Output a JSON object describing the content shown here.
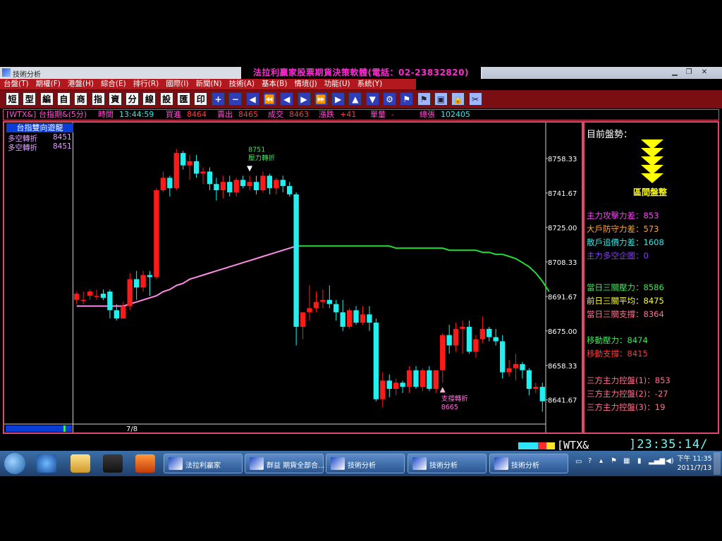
{
  "window": {
    "app_title": "技術分析",
    "banner": "法拉利贏家股票期貨決策軟體(電話：02-23832820)"
  },
  "menu": [
    "台盤(T)",
    "期權(F)",
    "港盤(H)",
    "綜合(E)",
    "排行(R)",
    "國際(I)",
    "新聞(N)",
    "技術(A)",
    "基本(B)",
    "情境(J)",
    "功能(U)",
    "系統(Y)"
  ],
  "toolbar": [
    "短",
    "型",
    "編",
    "自",
    "商",
    "指",
    "資",
    "分",
    "線",
    "設",
    "匯",
    "印"
  ],
  "infobar": {
    "symbol": "[WTX&]",
    "name": "台指期&(5分)",
    "time_label": "時間",
    "time": "13:44:59",
    "bid_label": "買進",
    "bid": "8464",
    "ask_label": "賣出",
    "ask": "8465",
    "deal_label": "成交",
    "deal": "8463",
    "change_label": "漲跌",
    "change": "+41",
    "volume_label": "單量",
    "volume": "-",
    "total_label": "總張",
    "total": "102405"
  },
  "legend": {
    "title": "台指雙向遊龍",
    "lines": [
      {
        "label": "多空轉折",
        "value": "8451"
      },
      {
        "label": "多空轉折",
        "value": "8451"
      }
    ]
  },
  "chart_data": {
    "type": "candlestick",
    "date_label": "7/8",
    "y_ticks": [
      "8758.33",
      "8741.67",
      "8725.00",
      "8708.33",
      "8691.67",
      "8675.00",
      "8658.33",
      "8641.67"
    ],
    "ylim": [
      8630,
      8775
    ],
    "annotations": [
      {
        "text_top": "8751",
        "text_bottom": "壓力轉折",
        "index": 26,
        "direction": "down"
      },
      {
        "text_top": "支撐轉折",
        "text_bottom": "8665",
        "index": 55,
        "direction": "up"
      }
    ],
    "candles": [
      [
        8690,
        8694,
        8688,
        8693
      ],
      [
        8690,
        8694,
        8688,
        8690
      ],
      [
        8692,
        8695,
        8690,
        8694
      ],
      [
        8692,
        8695,
        8690,
        8692
      ],
      [
        8693,
        8695,
        8690,
        8691
      ],
      [
        8694,
        8695,
        8681,
        8685
      ],
      [
        8685,
        8688,
        8680,
        8681
      ],
      [
        8681,
        8689,
        8681,
        8687
      ],
      [
        8687,
        8703,
        8685,
        8700
      ],
      [
        8700,
        8704,
        8690,
        8696
      ],
      [
        8696,
        8704,
        8694,
        8702
      ],
      [
        8702,
        8704,
        8692,
        8701
      ],
      [
        8701,
        8744,
        8700,
        8743
      ],
      [
        8743,
        8752,
        8742,
        8749
      ],
      [
        8749,
        8750,
        8740,
        8744
      ],
      [
        8744,
        8763,
        8743,
        8761
      ],
      [
        8761,
        8762,
        8753,
        8755
      ],
      [
        8755,
        8760,
        8748,
        8757
      ],
      [
        8757,
        8760,
        8749,
        8751
      ],
      [
        8751,
        8754,
        8746,
        8752
      ],
      [
        8752,
        8754,
        8743,
        8746
      ],
      [
        8746,
        8749,
        8738,
        8743
      ],
      [
        8743,
        8750,
        8739,
        8747
      ],
      [
        8747,
        8750,
        8740,
        8742
      ],
      [
        8742,
        8749,
        8740,
        8748
      ],
      [
        8748,
        8750,
        8744,
        8745
      ],
      [
        8745,
        8750,
        8743,
        8747
      ],
      [
        8747,
        8750,
        8741,
        8743
      ],
      [
        8743,
        8752,
        8742,
        8750
      ],
      [
        8750,
        8751,
        8741,
        8744
      ],
      [
        8744,
        8749,
        8741,
        8748
      ],
      [
        8748,
        8750,
        8742,
        8745
      ],
      [
        8745,
        8747,
        8740,
        8741
      ],
      [
        8741,
        8742,
        8668,
        8677
      ],
      [
        8677,
        8684,
        8671,
        8684
      ],
      [
        8684,
        8697,
        8680,
        8686
      ],
      [
        8686,
        8694,
        8684,
        8689
      ],
      [
        8689,
        8695,
        8686,
        8690
      ],
      [
        8690,
        8697,
        8686,
        8688
      ],
      [
        8688,
        8690,
        8680,
        8684
      ],
      [
        8684,
        8690,
        8675,
        8677
      ],
      [
        8677,
        8686,
        8676,
        8685
      ],
      [
        8685,
        8687,
        8678,
        8679
      ],
      [
        8679,
        8687,
        8678,
        8683
      ],
      [
        8683,
        8687,
        8675,
        8679
      ],
      [
        8679,
        8681,
        8641,
        8642
      ],
      [
        8642,
        8655,
        8638,
        8651
      ],
      [
        8651,
        8654,
        8643,
        8647
      ],
      [
        8647,
        8652,
        8644,
        8650
      ],
      [
        8650,
        8651,
        8645,
        8648
      ],
      [
        8648,
        8658,
        8645,
        8656
      ],
      [
        8656,
        8658,
        8647,
        8648
      ],
      [
        8648,
        8657,
        8646,
        8656
      ],
      [
        8656,
        8658,
        8646,
        8647
      ],
      [
        8647,
        8656,
        8645,
        8656
      ],
      [
        8656,
        8674,
        8650,
        8673
      ],
      [
        8673,
        8678,
        8664,
        8668
      ],
      [
        8668,
        8679,
        8665,
        8676
      ],
      [
        8676,
        8680,
        8664,
        8677
      ],
      [
        8677,
        8680,
        8664,
        8665
      ],
      [
        8665,
        8673,
        8662,
        8671
      ],
      [
        8671,
        8682,
        8669,
        8676
      ],
      [
        8676,
        8677,
        8670,
        8672
      ],
      [
        8672,
        8676,
        8668,
        8670
      ],
      [
        8670,
        8673,
        8652,
        8655
      ],
      [
        8655,
        8661,
        8653,
        8657
      ],
      [
        8657,
        8664,
        8651,
        8659
      ],
      [
        8659,
        8660,
        8652,
        8656
      ],
      [
        8656,
        8657,
        8644,
        8647
      ],
      [
        8647,
        8650,
        8645,
        8648
      ],
      [
        8648,
        8650,
        8636,
        8641
      ]
    ],
    "ma_split_index": 33,
    "ma": [
      8687,
      8687,
      8687,
      8687,
      8687,
      8687,
      8687,
      8687,
      8688,
      8689,
      8690,
      8691,
      8692,
      8694,
      8695,
      8697,
      8698,
      8700,
      8701,
      8702,
      8703,
      8704,
      8705,
      8706,
      8707,
      8708,
      8709,
      8710,
      8711,
      8712,
      8713,
      8714,
      8715,
      8716,
      8716,
      8716,
      8716,
      8716,
      8716,
      8716,
      8716,
      8716,
      8716,
      8716,
      8716,
      8716,
      8716,
      8716,
      8715,
      8715,
      8715,
      8715,
      8715,
      8715,
      8715,
      8715,
      8714,
      8714,
      8714,
      8714,
      8714,
      8713,
      8713,
      8712,
      8712,
      8711,
      8710,
      8708,
      8706,
      8703,
      8699,
      8694
    ]
  },
  "right_panel": {
    "trend_title": "目前盤勢：",
    "trend_label": "區間盤整",
    "stats": [
      {
        "label": "主力攻擊力差：",
        "value": "853",
        "color": "#ff3dff"
      },
      {
        "label": "大戶防守力差：",
        "value": "573",
        "color": "#ffa640"
      },
      {
        "label": "散戶追價力差：",
        "value": "1608",
        "color": "#3be6e6"
      },
      {
        "label": "主力多空企圖：",
        "value": "0",
        "color": "#8a3cff"
      }
    ],
    "levels": [
      {
        "label": "當日三關壓力：",
        "value": "8586",
        "color": "#3ee65a"
      },
      {
        "label": "前日三關平均：",
        "value": "8475",
        "color": "#ffff33"
      },
      {
        "label": "當日三關支撐：",
        "value": "8364",
        "color": "#ff6f8f"
      }
    ],
    "moving": [
      {
        "label": "移動壓力：",
        "value": "8474",
        "color": "#3ee65a"
      },
      {
        "label": "移動支撐：",
        "value": "8415",
        "color": "#ff3a3a"
      }
    ],
    "three_way": [
      {
        "label": "三方主力控盤(1)：",
        "value": "853",
        "color": "#ff6f8f"
      },
      {
        "label": "三方主力控盤(2)：",
        "value": "-27",
        "color": "#ff6f8f"
      },
      {
        "label": "三方主力控盤(3)：",
        "value": "19",
        "color": "#ff6f8f"
      }
    ]
  },
  "statusbar": {
    "symbol": "[WTX&_",
    "clock": "]23:35:14/"
  },
  "taskbar": {
    "buttons": [
      "法拉利贏家",
      "群益 期貨全部合...",
      "技術分析",
      "技術分析",
      "技術分析"
    ],
    "tray_time": "下午 11:35",
    "tray_date": "2011/7/13"
  }
}
